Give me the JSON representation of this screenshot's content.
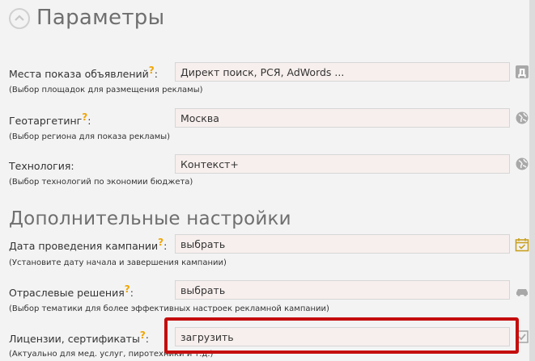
{
  "header": {
    "title": "Параметры"
  },
  "section2": {
    "title": "Дополнительные настройки"
  },
  "fields": [
    {
      "label": "Места показа объявлений",
      "q": "?",
      "colon": ":",
      "hint": "(Выбор площадок для размещения рекламы)",
      "value": "Директ поиск, РСЯ, AdWords ...",
      "icon": "letter-d-icon"
    },
    {
      "label": "Геотаргетинг",
      "q": "?",
      "colon": ":",
      "hint": "(Выбор региона для показа рекламы)",
      "value": "Москва",
      "icon": "globe-icon"
    },
    {
      "label": "Технология:",
      "q": "",
      "colon": "",
      "hint": "(Выбор технологий по экономии бюджета)",
      "value": "Контекст+",
      "icon": "globe-icon"
    },
    {
      "label": "Дата проведения кампании",
      "q": "?",
      "colon": ":",
      "hint": "(Установите дату начала и завершения кампании)",
      "value": "выбрать",
      "icon": "calendar-icon"
    },
    {
      "label": "Отраслевые решения",
      "q": "?",
      "colon": ":",
      "hint": "(Выбор тематики для более эффективных настроек рекламной кампании)",
      "value": "выбрать",
      "icon": "car-icon"
    },
    {
      "label": "Лицензии, сертификаты",
      "q": "?",
      "colon": ":",
      "hint": "(Актуально для мед. услуг, пиротехники и т.д.)",
      "value": "загрузить",
      "icon": "checkbox-icon"
    }
  ]
}
